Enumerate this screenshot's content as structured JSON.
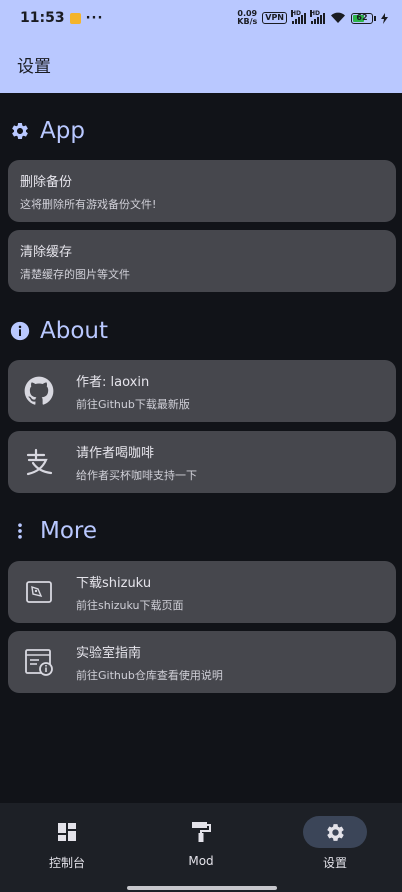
{
  "status_bar": {
    "time": "11:53",
    "more": "···",
    "speed_value": "0.09",
    "speed_unit": "KB/s",
    "vpn": "VPN",
    "signal1_label": "HD",
    "signal2_label": "HD",
    "battery_level": "62"
  },
  "app_bar": {
    "title": "设置"
  },
  "sections": {
    "app": {
      "title": "App",
      "icon": "gear-icon",
      "items": [
        {
          "title": "删除备份",
          "subtitle": "这将删除所有游戏备份文件!"
        },
        {
          "title": "清除缓存",
          "subtitle": "清楚缓存的图片等文件"
        }
      ]
    },
    "about": {
      "title": "About",
      "icon": "info-icon",
      "items": [
        {
          "title": "作者: laoxin",
          "subtitle": "前往Github下载最新版",
          "icon": "github-icon"
        },
        {
          "title": "请作者喝咖啡",
          "subtitle": "给作者买杯咖啡支持一下",
          "icon": "alipay-icon"
        }
      ]
    },
    "more": {
      "title": "More",
      "icon": "more-vert-icon",
      "items": [
        {
          "title": "下载shizuku",
          "subtitle": "前往shizuku下载页面",
          "icon": "shizuku-icon"
        },
        {
          "title": "实验室指南",
          "subtitle": "前往Github仓库查看使用说明",
          "icon": "guide-icon"
        }
      ]
    }
  },
  "bottom_nav": {
    "items": [
      {
        "label": "控制台",
        "icon": "dashboard-icon"
      },
      {
        "label": "Mod",
        "icon": "paint-roller-icon"
      },
      {
        "label": "设置",
        "icon": "gear-icon",
        "active": true
      }
    ]
  },
  "colors": {
    "accent": "#b9c8ff",
    "background": "#111318",
    "card": "#46474d",
    "nav_background": "#1d2026",
    "active_pill": "#3b4558",
    "battery": "#2db54a"
  }
}
